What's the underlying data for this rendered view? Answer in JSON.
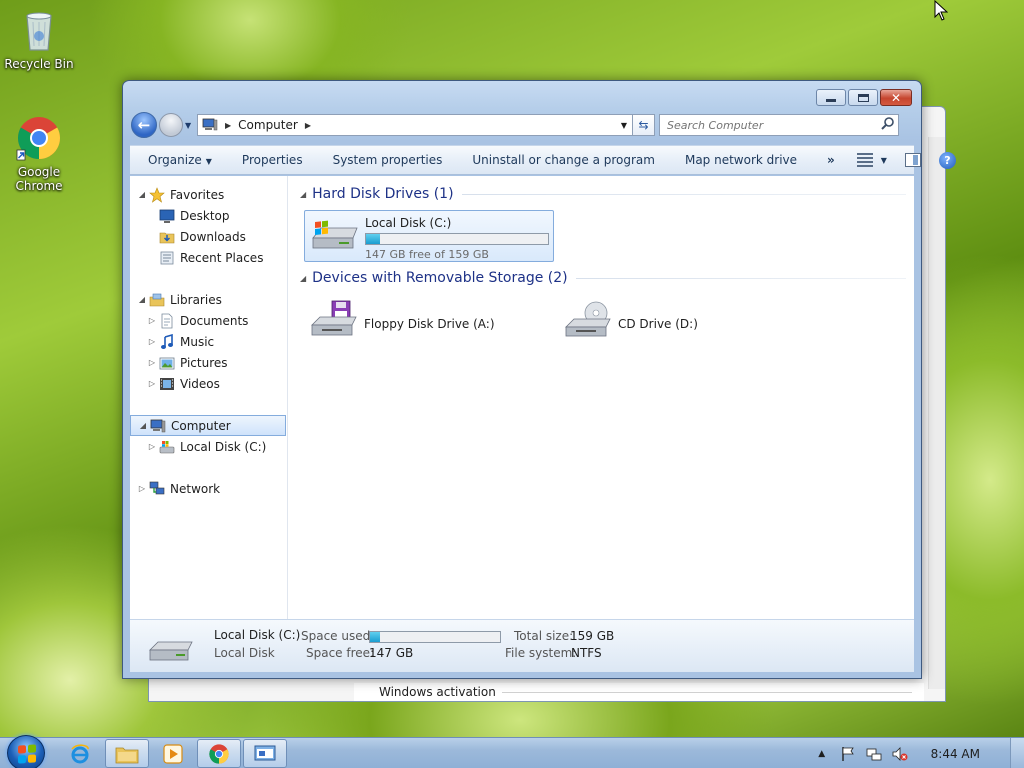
{
  "desktop": {
    "icons": [
      {
        "label": "Recycle Bin"
      },
      {
        "label": "Google Chrome"
      }
    ]
  },
  "back_window": {
    "visible_text": "Windows activation"
  },
  "window": {
    "address": {
      "segments": [
        "Computer"
      ]
    },
    "search": {
      "placeholder": "Search Computer"
    },
    "toolbar": {
      "organize": "Organize",
      "properties": "Properties",
      "system_properties": "System properties",
      "uninstall": "Uninstall or change a program",
      "map_network": "Map network drive",
      "more": "»"
    },
    "nav": {
      "favorites": "Favorites",
      "desktop": "Desktop",
      "downloads": "Downloads",
      "recent_places": "Recent Places",
      "libraries": "Libraries",
      "documents": "Documents",
      "music": "Music",
      "pictures": "Pictures",
      "videos": "Videos",
      "computer": "Computer",
      "local_disk": "Local Disk (C:)",
      "network": "Network"
    },
    "groups": {
      "hard_disks": {
        "title": "Hard Disk Drives (1)",
        "drives": [
          {
            "name": "Local Disk (C:)",
            "free_text": "147 GB free of 159 GB",
            "used_fraction": 0.075
          }
        ]
      },
      "removable": {
        "title": "Devices with Removable Storage (2)",
        "devices": [
          {
            "name": "Floppy Disk Drive (A:)"
          },
          {
            "name": "CD Drive (D:)"
          }
        ]
      }
    },
    "details": {
      "name": "Local Disk (C:)",
      "type": "Local Disk",
      "space_used_label": "Space used:",
      "space_free_label": "Space free:",
      "space_free": "147 GB",
      "total_size_label": "Total size:",
      "total_size": "159 GB",
      "file_system_label": "File system:",
      "file_system": "NTFS",
      "used_fraction": 0.075
    }
  },
  "taskbar": {
    "clock": "8:44 AM",
    "colors": {
      "logo_red": "#f25022",
      "logo_green": "#7fba00",
      "logo_blue": "#00a4ef",
      "logo_yellow": "#ffb900"
    }
  }
}
